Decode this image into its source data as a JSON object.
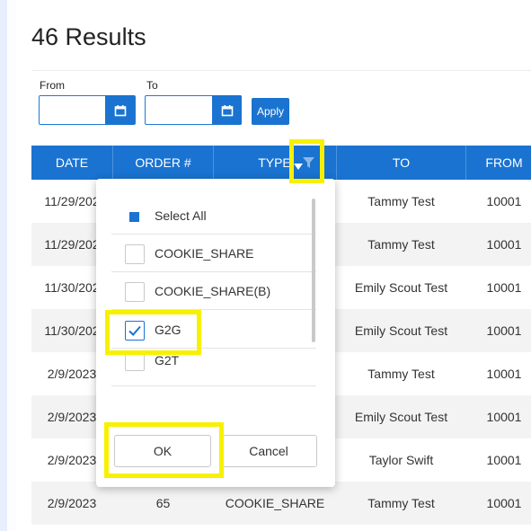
{
  "header": {
    "title": "46 Results"
  },
  "filters": {
    "from_label": "From",
    "to_label": "To",
    "from_value": "",
    "to_value": "",
    "apply_label": "Apply"
  },
  "table": {
    "columns": [
      "DATE",
      "ORDER #",
      "TYPE",
      "TO",
      "FROM"
    ],
    "rows": [
      {
        "date": "11/29/202",
        "order": "",
        "type": "",
        "to": "Tammy Test",
        "from": "10001"
      },
      {
        "date": "11/29/202",
        "order": "",
        "type": "",
        "to": "Tammy Test",
        "from": "10001"
      },
      {
        "date": "11/30/202",
        "order": "",
        "type": "",
        "to": "Emily Scout Test",
        "from": "10001"
      },
      {
        "date": "11/30/202",
        "order": "",
        "type": "",
        "to": "Emily Scout Test",
        "from": "10001"
      },
      {
        "date": "2/9/2023",
        "order": "",
        "type": "",
        "to": "Tammy Test",
        "from": "10001"
      },
      {
        "date": "2/9/2023",
        "order": "",
        "type": "",
        "to": "Emily Scout Test",
        "from": "10001"
      },
      {
        "date": "2/9/2023",
        "order": "",
        "type": "",
        "to": "Taylor Swift",
        "from": "10001"
      },
      {
        "date": "2/9/2023",
        "order": "65",
        "type": "COOKIE_SHARE",
        "to": "Tammy Test",
        "from": "10001"
      }
    ]
  },
  "type_filter": {
    "options": [
      {
        "label": "Select All",
        "state": "partial"
      },
      {
        "label": "COOKIE_SHARE",
        "state": "unchecked"
      },
      {
        "label": "COOKIE_SHARE(B)",
        "state": "unchecked"
      },
      {
        "label": "G2G",
        "state": "checked"
      },
      {
        "label": "G2T",
        "state": "unchecked"
      }
    ],
    "ok_label": "OK",
    "cancel_label": "Cancel"
  },
  "colors": {
    "accent": "#1a73d0",
    "highlight": "#f7f100",
    "row_alt": "#f3f3f3"
  },
  "icons": [
    "calendar-icon",
    "sort-down-icon",
    "filter-icon",
    "checkmark-icon"
  ]
}
